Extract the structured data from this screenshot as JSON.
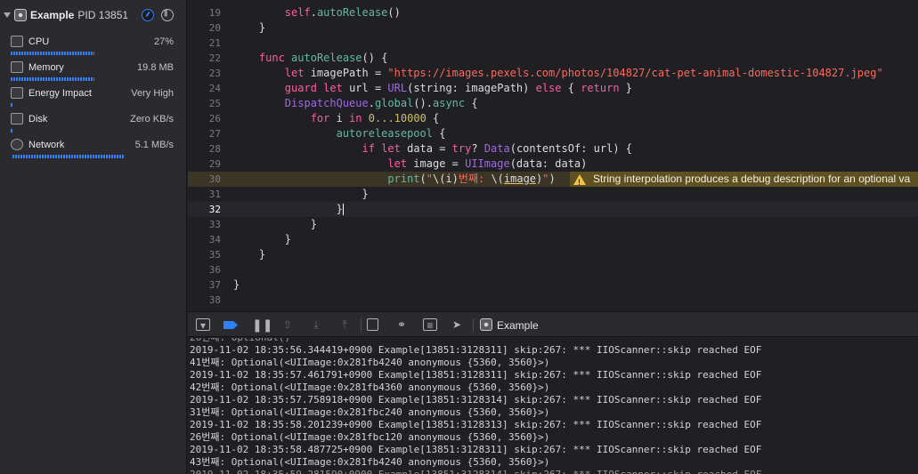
{
  "navigator": {
    "process_name": "Example",
    "process_pid": "PID 13851",
    "gauges": [
      {
        "label": "CPU",
        "value": "27%",
        "icon": "cpu-icon"
      },
      {
        "label": "Memory",
        "value": "19.8 MB",
        "icon": "memory-icon"
      },
      {
        "label": "Energy Impact",
        "value": "Very High",
        "icon": "battery-icon"
      },
      {
        "label": "Disk",
        "value": "Zero KB/s",
        "icon": "disk-icon"
      },
      {
        "label": "Network",
        "value": "5.1 MB/s",
        "icon": "globe-icon"
      }
    ]
  },
  "editor": {
    "current_line": 32,
    "warning_line": 30,
    "lines": [
      {
        "n": "19",
        "code": "        self.autoRelease()"
      },
      {
        "n": "20",
        "code": "    }"
      },
      {
        "n": "21",
        "code": ""
      },
      {
        "n": "22",
        "code": "    func autoRelease() {"
      },
      {
        "n": "23",
        "code": "        let imagePath = \"https://images.pexels.com/photos/104827/cat-pet-animal-domestic-104827.jpeg\""
      },
      {
        "n": "24",
        "code": "        guard let url = URL(string: imagePath) else { return }"
      },
      {
        "n": "25",
        "code": "        DispatchQueue.global().async {"
      },
      {
        "n": "26",
        "code": "            for i in 0...10000 {"
      },
      {
        "n": "27",
        "code": "                autoreleasepool {"
      },
      {
        "n": "28",
        "code": "                    if let data = try? Data(contentsOf: url) {"
      },
      {
        "n": "29",
        "code": "                        let image = UIImage(data: data)"
      },
      {
        "n": "30",
        "code": "                        print(\"\\(i)번째: \\(image)\")"
      },
      {
        "n": "31",
        "code": "                    }"
      },
      {
        "n": "32",
        "code": "                }"
      },
      {
        "n": "33",
        "code": "            }"
      },
      {
        "n": "34",
        "code": "        }"
      },
      {
        "n": "35",
        "code": "    }"
      },
      {
        "n": "36",
        "code": ""
      },
      {
        "n": "37",
        "code": "}"
      },
      {
        "n": "38",
        "code": ""
      }
    ],
    "warning_text": "String interpolation produces a debug description for an optional va"
  },
  "debug_bar": {
    "scheme_label": "Example",
    "buttons": [
      "hide-console",
      "breakpoints",
      "pause",
      "step-over",
      "step-into",
      "step-out",
      "view-hierarchy",
      "memory-graph",
      "environment-overrides",
      "simulate-location"
    ]
  },
  "console": {
    "lines": [
      "2019-11-02 18:35:56.344419+0900 Example[13851:3128311] skip:267: *** IIOScanner::skip reached EOF",
      "41번째: Optional(<UIImage:0x281fb4240 anonymous {5360, 3560}>)",
      "2019-11-02 18:35:57.461791+0900 Example[13851:3128311] skip:267: *** IIOScanner::skip reached EOF",
      "42번째: Optional(<UIImage:0x281fb4360 anonymous {5360, 3560}>)",
      "2019-11-02 18:35:57.758918+0900 Example[13851:3128314] skip:267: *** IIOScanner::skip reached EOF",
      "31번째: Optional(<UIImage:0x281fbc240 anonymous {5360, 3560}>)",
      "2019-11-02 18:35:58.201239+0900 Example[13851:3128313] skip:267: *** IIOScanner::skip reached EOF",
      "26번째: Optional(<UIImage:0x281fbc120 anonymous {5360, 3560}>)",
      "2019-11-02 18:35:58.487725+0900 Example[13851:3128311] skip:267: *** IIOScanner::skip reached EOF",
      "43번째: Optional(<UIImage:0x281fb4240 anonymous {5360, 3560}>)"
    ]
  }
}
